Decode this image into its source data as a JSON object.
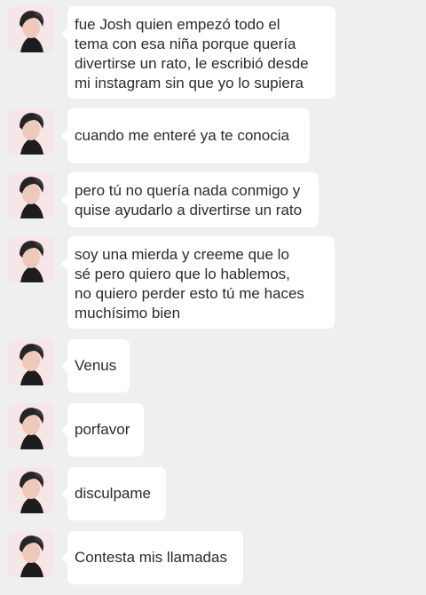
{
  "thread": {
    "messages": [
      {
        "text": "fue Josh quien empezó todo el\ntema con esa niña porque quería\ndivertirse un rato, le escribió desde\nmi instagram sin que yo lo supiera"
      },
      {
        "text": "cuando me enteré ya te conocia"
      },
      {
        "text": "pero tú no quería nada conmigo y\nquise ayudarlo a divertirse un rato"
      },
      {
        "text": "soy una mierda y creeme que lo\nsé pero quiero que lo hablemos,\nno quiero perder esto tú me haces\nmuchísimo bien"
      },
      {
        "text": "Venus"
      },
      {
        "text": "porfavor"
      },
      {
        "text": "disculpame"
      },
      {
        "text": "Contesta mis llamadas"
      }
    ]
  },
  "colors": {
    "background": "#efefef",
    "bubble": "#ffffff",
    "text": "#2b2b2b",
    "avatar_bg": "#f7e6e8"
  },
  "icons": {
    "avatar": "profile-photo-icon"
  }
}
